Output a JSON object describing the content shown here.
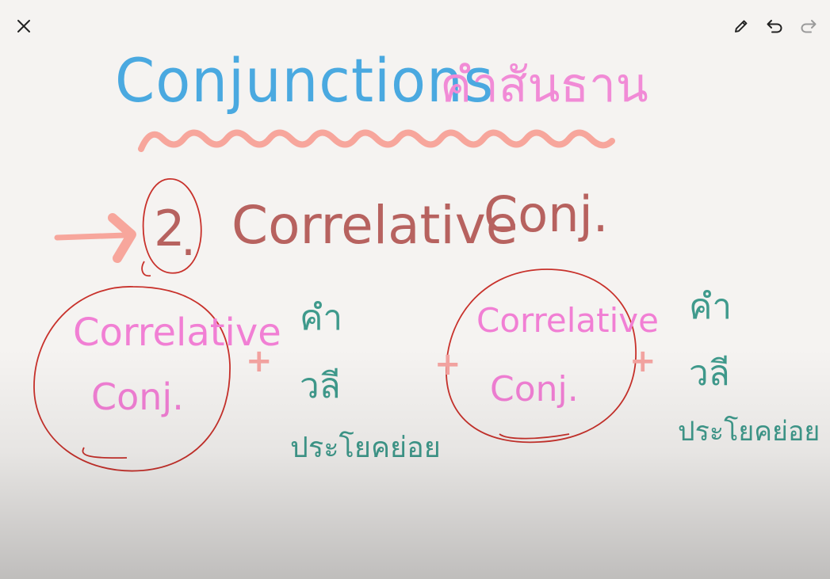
{
  "toolbar": {
    "close_icon": "close-icon",
    "pen_icon": "pencil-icon",
    "undo_icon": "undo-icon",
    "redo_icon": "redo-icon"
  },
  "board": {
    "title_en": "Conjunctions",
    "title_th": "คำสันธาน",
    "heading_number": "2",
    "heading_dot": ".",
    "heading_main": "Correlative",
    "heading_conj": "Conj.",
    "group1": {
      "line1": "Correlative",
      "line2": "Conj."
    },
    "group2": {
      "line1": "Correlative",
      "line2": "Conj."
    },
    "plus": "+",
    "words1": [
      "คำ",
      "วลี",
      "ประโยคย่อย"
    ],
    "words2": [
      "คำ",
      "วลี",
      "ประโยคย่อย"
    ]
  },
  "colors": {
    "background": "#f5f3f1",
    "title_blue": "#4aa9e0",
    "title_pink": "#f18bd6",
    "heading_brown": "#b7625f",
    "circle_red": "#c8312b",
    "text_pink": "#f17fd4",
    "plus_salmon": "#f3a3a0",
    "text_teal": "#3f9a8c",
    "wave_salmon": "#f7a69c",
    "arrow_salmon": "#f7a69c"
  }
}
